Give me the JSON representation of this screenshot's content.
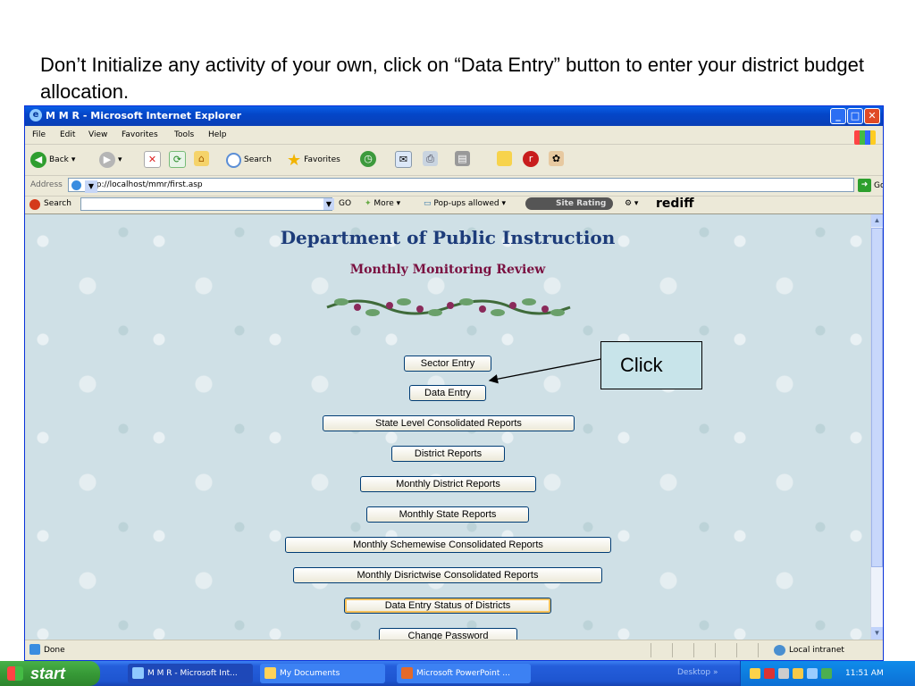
{
  "caption": "Don’t Initialize any activity of your own, click on “Data Entry” button to enter your district budget allocation.",
  "window": {
    "title": "M M R - Microsoft Internet Explorer"
  },
  "menu": [
    "File",
    "Edit",
    "View",
    "Favorites",
    "Tools",
    "Help"
  ],
  "toolbar": {
    "back": "Back",
    "search": "Search",
    "favorites": "Favorites"
  },
  "address": {
    "label": "Address",
    "url": "http://localhost/mmr/first.asp",
    "go": "Go"
  },
  "searchbar": {
    "label": "Search",
    "go": "GO",
    "more": "More",
    "popups": "Pop-ups allowed",
    "site_rating": "Site Rating",
    "brand": "rediff"
  },
  "page": {
    "heading": "Department of Public Instruction",
    "subheading": "Monthly Monitoring Review",
    "buttons": [
      "Sector Entry",
      "Data Entry",
      "State Level Consolidated Reports",
      "District Reports",
      "Monthly District Reports",
      "Monthly State Reports",
      "Monthly Schemewise Consolidated Reports",
      "Monthly Disrictwise Consolidated Reports",
      "Data Entry Status of Districts",
      "Change Password"
    ]
  },
  "status": {
    "text": "Done",
    "zone": "Local intranet"
  },
  "taskbar": {
    "start": "start",
    "tasks": [
      "M M R - Microsoft Int...",
      "My Documents",
      "Microsoft PowerPoint ..."
    ],
    "desktop": "Desktop",
    "clock": "11:51 AM"
  },
  "callout": {
    "text": "Click"
  },
  "colors": {
    "heading": "#1d3c7a",
    "subheading": "#7a1040",
    "titlebar": "#0a5fe6",
    "callout_bg": "#c8e4ea"
  }
}
